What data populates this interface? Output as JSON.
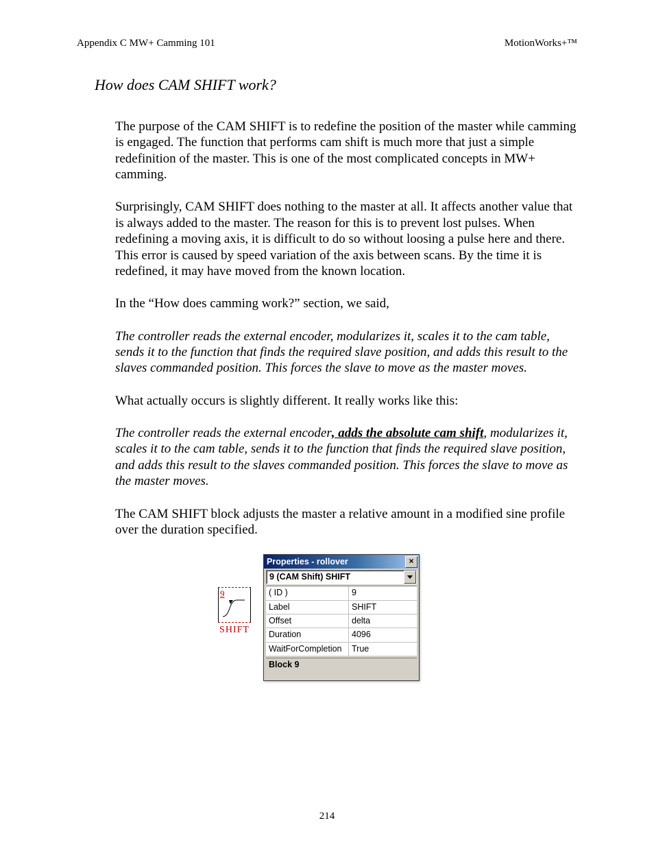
{
  "header": {
    "left": "Appendix C MW+ Camming 101",
    "right": "MotionWorks+™"
  },
  "title": "How does CAM SHIFT work?",
  "paragraphs": {
    "p1": "The purpose of the CAM SHIFT is to redefine the position of the master while camming is engaged.  The function that performs cam shift is much more that just a simple redefinition of the master.  This is one of the most complicated concepts in MW+ camming.",
    "p2": "Surprisingly, CAM SHIFT does nothing to the master at all.  It affects another value that is always added to the master.  The reason for this is to prevent lost pulses.  When redefining a moving axis, it is difficult to do so without loosing a pulse here and there.  This error is caused by speed variation of the axis between scans.  By the time it is redefined, it may have moved from the known location.",
    "p3": "In the “How does camming work?” section, we said,",
    "p4": "The controller reads the external encoder, modularizes it, scales it to the cam table, sends it to the function that finds the required slave position, and adds this result to the slaves commanded position.  This forces the slave to move as the master moves.",
    "p5": "What actually occurs is slightly different.  It really works like this:",
    "p6a": "The controller reads the external encoder",
    "p6b": ", adds the absolute cam shift",
    "p6c": ", modularizes it, scales it to the cam table, sends it to the function that finds the required slave position, and adds this result to the slaves commanded position.  This forces the slave to move as the master moves.",
    "p7": "The CAM SHIFT block adjusts the master a relative amount in a modified sine profile over the duration specified."
  },
  "shift_icon": {
    "number": "9",
    "label": "SHIFT"
  },
  "properties": {
    "title": "Properties - rollover",
    "combo": "9 (CAM Shift) SHIFT",
    "rows": [
      {
        "k": "( ID )",
        "v": "9"
      },
      {
        "k": "Label",
        "v": "SHIFT"
      },
      {
        "k": "Offset",
        "v": "delta"
      },
      {
        "k": "Duration",
        "v": "4096"
      },
      {
        "k": "WaitForCompletion",
        "v": "True"
      }
    ],
    "footer": "Block 9"
  },
  "page_number": "214"
}
